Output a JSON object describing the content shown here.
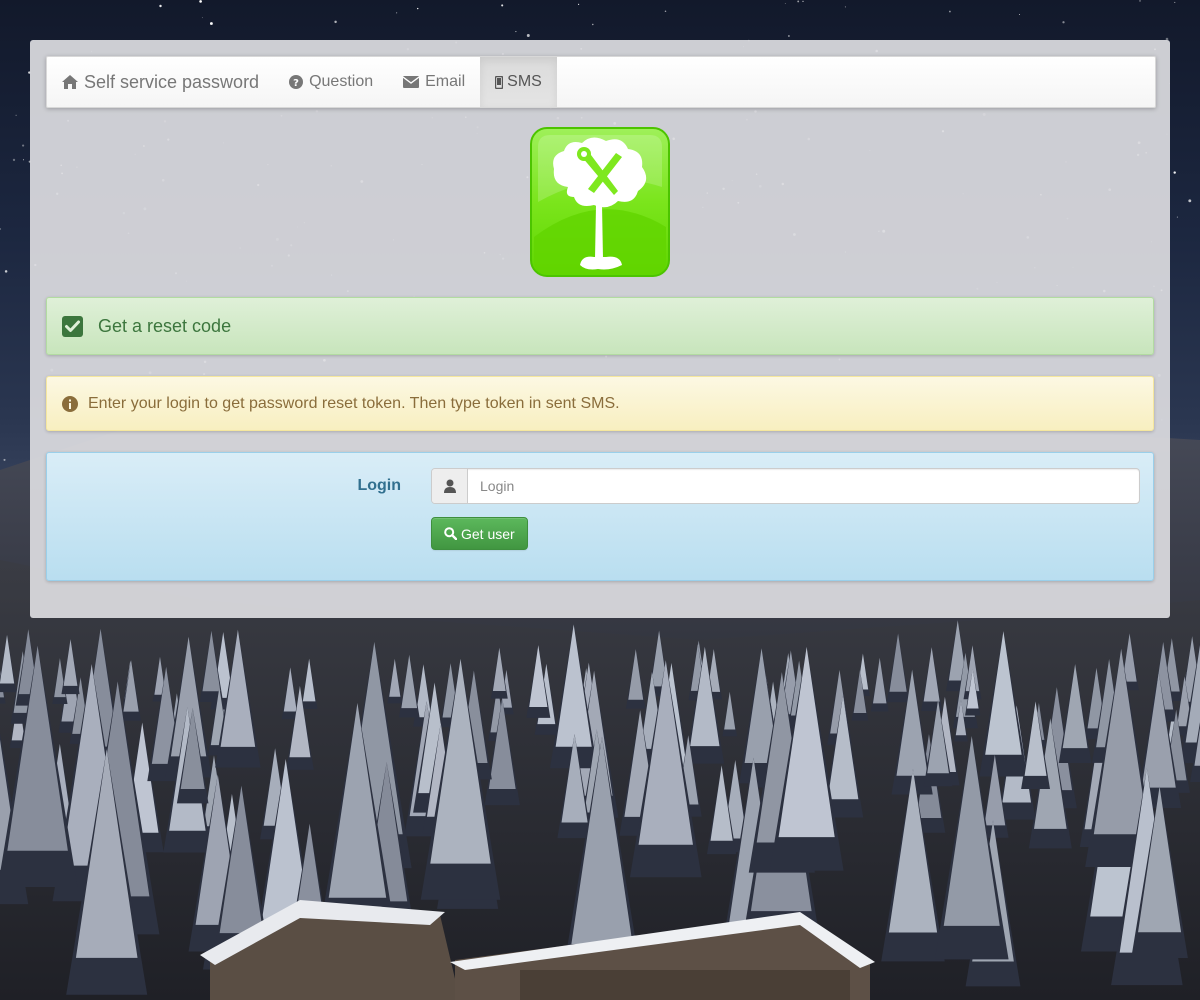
{
  "navbar": {
    "brand": "Self service password",
    "brand_icon": "home-icon",
    "items": [
      {
        "label": "Question",
        "icon": "question-circle-icon",
        "active": false
      },
      {
        "label": "Email",
        "icon": "envelope-icon",
        "active": false
      },
      {
        "label": "SMS",
        "icon": "mobile-phone-icon",
        "active": true
      }
    ]
  },
  "logo": {
    "icon": "tree-with-wrench-logo",
    "color": "#66dd00"
  },
  "alerts": {
    "success": {
      "icon": "check-square-icon",
      "text": "Get a reset code"
    },
    "warning": {
      "icon": "info-circle-icon",
      "text": "Enter your login to get password reset token. Then type token in sent SMS."
    }
  },
  "form": {
    "login_label": "Login",
    "login_input": {
      "value": "",
      "placeholder": "Login",
      "icon": "user-icon"
    },
    "submit": {
      "label": "Get user",
      "icon": "search-icon"
    }
  },
  "colors": {
    "success_text": "#3c763d",
    "warning_text": "#8a6d3b",
    "info_text": "#31708f",
    "button_green": "#5cb85c"
  }
}
